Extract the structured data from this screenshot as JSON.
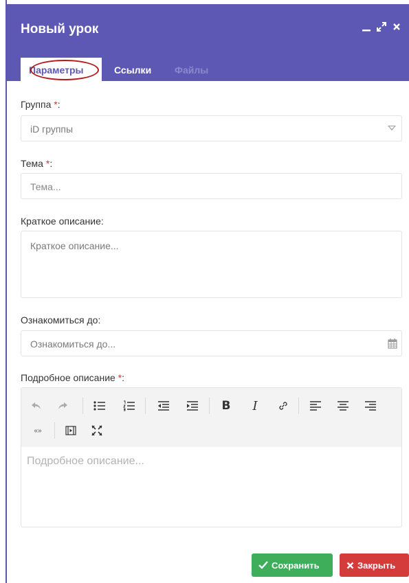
{
  "window": {
    "title": "Новый урок",
    "controls": [
      "minimize-icon",
      "maximize-icon",
      "close-icon"
    ]
  },
  "tabs": [
    {
      "label": "Параметры",
      "active": true
    },
    {
      "label": "Ссылки",
      "active": false
    },
    {
      "label": "Файлы",
      "active": false,
      "disabled": true
    }
  ],
  "form": {
    "group": {
      "label": "Группа",
      "required_mark": "*",
      "colon": ":",
      "placeholder": "iD группы"
    },
    "topic": {
      "label": "Тема",
      "required_mark": "*",
      "colon": ":",
      "placeholder": "Тема..."
    },
    "short_description": {
      "label": "Краткое описание:",
      "placeholder": "Краткое описание..."
    },
    "review_until": {
      "label": "Ознакомиться до:",
      "placeholder": "Ознакомиться до..."
    },
    "detailed_description": {
      "label": "Подробное описание",
      "required_mark": "*",
      "colon": ":",
      "placeholder": "Подробное описание..."
    }
  },
  "editor_toolbar": [
    "undo-icon",
    "redo-icon",
    "bullet-list-icon",
    "numbered-list-icon",
    "outdent-icon",
    "indent-icon",
    "bold-icon",
    "italic-icon",
    "link-icon",
    "align-left-icon",
    "align-center-icon",
    "align-right-icon",
    "blockquote-icon",
    "media-icon",
    "fullscreen-icon"
  ],
  "editor_toolbar_glyphs": {
    "bold": "B",
    "italic": "I",
    "blockquote": "«»"
  },
  "actions": {
    "save_label": "Сохранить",
    "close_label": "Закрыть"
  },
  "colors": {
    "header": "#5c58b3",
    "required": "#d9302c",
    "save": "#3fae5b",
    "close": "#d43c3c",
    "highlight_circle": "#b21c1c"
  }
}
